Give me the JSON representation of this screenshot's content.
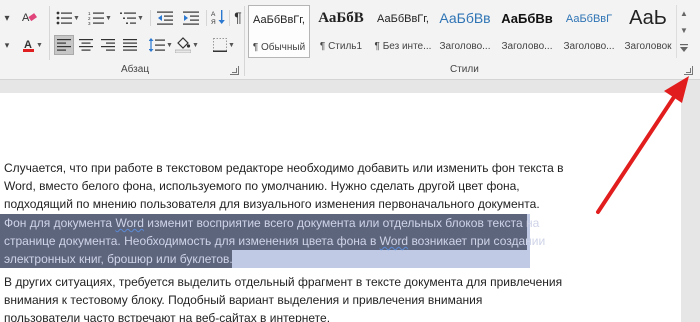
{
  "ribbon": {
    "paragraph_group": {
      "label": "Абзац"
    },
    "styles_group": {
      "label": "Стили"
    },
    "styles": [
      {
        "sample": "АаБбВвГг,",
        "name": "¶ Обычный",
        "selected": true
      },
      {
        "sample": "АаБбВ",
        "name": "¶ Стиль1",
        "selected": false
      },
      {
        "sample": "АаБбВвГг,",
        "name": "¶ Без инте...",
        "selected": false
      },
      {
        "sample": "АаБбВв",
        "name": "Заголово...",
        "selected": false
      },
      {
        "sample": "АаБбВв",
        "name": "Заголово...",
        "selected": false
      },
      {
        "sample": "АаБбВвГ",
        "name": "Заголово...",
        "selected": false
      },
      {
        "sample": "АаЬ",
        "name": "Заголовок",
        "selected": false
      }
    ]
  },
  "document": {
    "p1": [
      "Случается, что при работе в текстовом редакторе необходимо добавить или изменить фон текста в",
      "Word, вместо белого фона, используемого по умолчанию. Нужно сделать другой цвет фона,",
      "подходящий по мнению пользователя для визуального изменения первоначального документа."
    ],
    "p2": {
      "line1_pre": "Фон для документа ",
      "line1_word": "Word",
      "line1_post": " изменит восприятие всего документа или отдельных блоков текста на",
      "line2_pre": "странице документа. Необходимость для изменения цвета фона в ",
      "line2_word": "Word",
      "line2_post": " возникает при создании",
      "line3": "электронных книг, брошюр или буклетов."
    },
    "p3": [
      "В других ситуациях, требуется выделить отдельный фрагмент в тексте документа для привлечения",
      "внимания к тестовому блоку. Подобный вариант выделения и привлечения внимания",
      "пользователи часто встречают на веб-сайтах в интернете."
    ]
  },
  "annotation": {
    "arrow_color": "#e21d1d"
  }
}
